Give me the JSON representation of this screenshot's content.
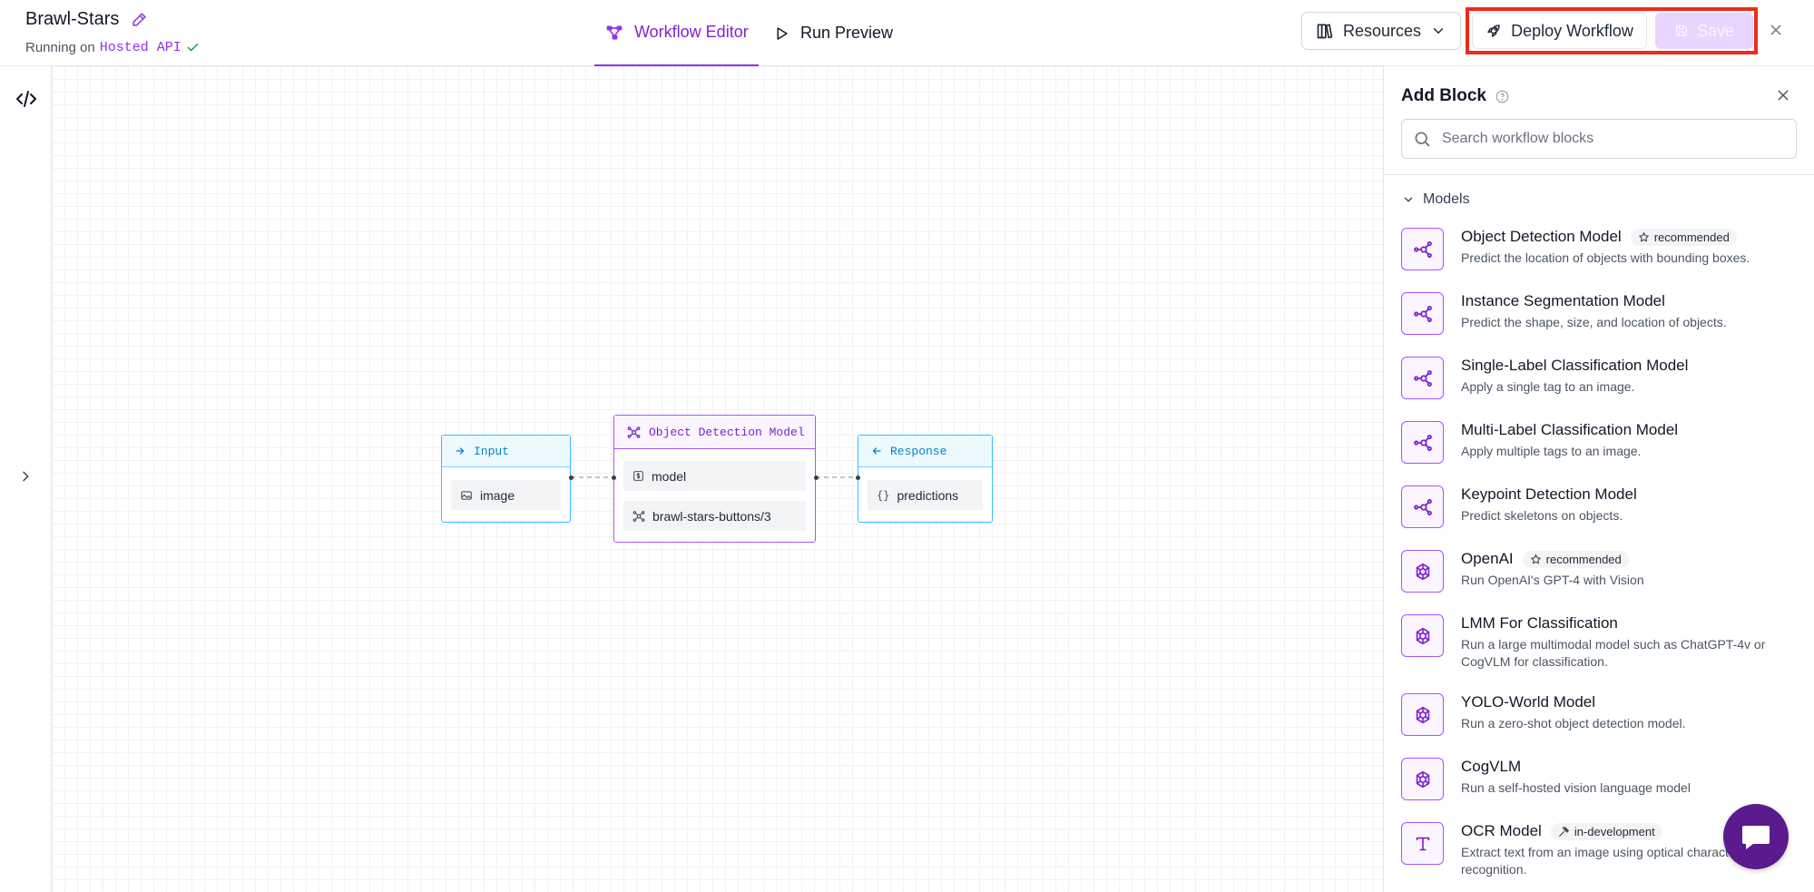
{
  "header": {
    "title": "Brawl-Stars",
    "running_prefix": "Running on",
    "running_api": "Hosted API",
    "tabs": [
      {
        "label": "Workflow Editor",
        "active": true
      },
      {
        "label": "Run Preview",
        "active": false
      }
    ],
    "resources_label": "Resources",
    "deploy_label": "Deploy Workflow",
    "save_label": "Save"
  },
  "canvas": {
    "nodes": {
      "input": {
        "title": "Input",
        "field": "image"
      },
      "model": {
        "title": "Object Detection Model",
        "fields": [
          "model",
          "brawl-stars-buttons/3"
        ]
      },
      "response": {
        "title": "Response",
        "field": "predictions"
      }
    }
  },
  "panel": {
    "title": "Add Block",
    "search_placeholder": "Search workflow blocks",
    "section": "Models",
    "blocks": [
      {
        "name": "Object Detection Model",
        "badge": "recommended",
        "badge_icon": "star-icon",
        "icon": "model-icon",
        "desc": "Predict the location of objects with bounding boxes."
      },
      {
        "name": "Instance Segmentation Model",
        "badge": "",
        "icon": "model-icon",
        "desc": "Predict the shape, size, and location of objects."
      },
      {
        "name": "Single-Label Classification Model",
        "badge": "",
        "icon": "model-icon",
        "desc": "Apply a single tag to an image."
      },
      {
        "name": "Multi-Label Classification Model",
        "badge": "",
        "icon": "model-icon",
        "desc": "Apply multiple tags to an image."
      },
      {
        "name": "Keypoint Detection Model",
        "badge": "",
        "icon": "model-icon",
        "desc": "Predict skeletons on objects."
      },
      {
        "name": "OpenAI",
        "badge": "recommended",
        "badge_icon": "star-icon",
        "icon": "openai-icon",
        "desc": "Run OpenAI's GPT-4 with Vision"
      },
      {
        "name": "LMM For Classification",
        "badge": "",
        "icon": "openai-icon",
        "desc": "Run a large multimodal model such as ChatGPT-4v or CogVLM for classification."
      },
      {
        "name": "YOLO-World Model",
        "badge": "",
        "icon": "openai-icon",
        "desc": "Run a zero-shot object detection model."
      },
      {
        "name": "CogVLM",
        "badge": "",
        "icon": "openai-icon",
        "desc": "Run a self-hosted vision language model"
      },
      {
        "name": "OCR Model",
        "badge": "in-development",
        "badge_icon": "hammer-icon",
        "icon": "text-icon",
        "desc": "Extract text from an image using optical character recognition."
      }
    ]
  },
  "colors": {
    "accent": "#9333ea",
    "highlight": "#ef2a1b",
    "io_node": "#38bdf8",
    "chat_button": "#5b1a8e"
  }
}
